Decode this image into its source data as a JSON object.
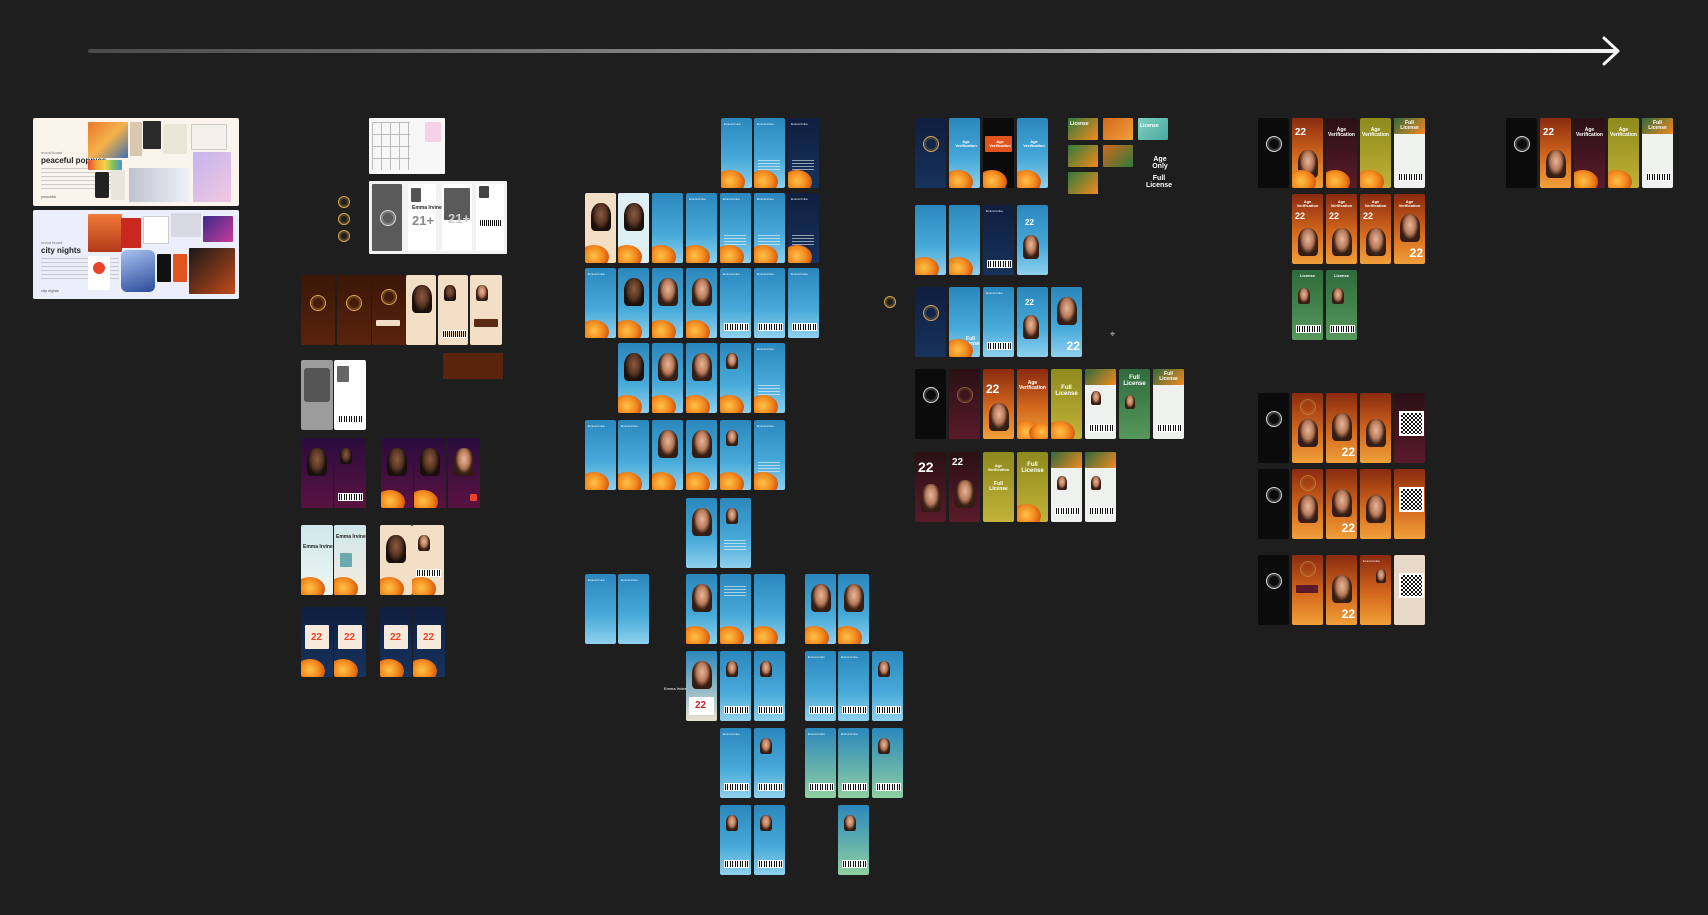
{
  "canvas": {
    "background": "#1e1e1e"
  },
  "moodboards": [
    {
      "eyebrow": "mood board",
      "title": "peaceful poppies",
      "body_label": "",
      "footer": "peaceful"
    },
    {
      "eyebrow": "mood board",
      "title": "city nights",
      "body_label": "",
      "footer": "city nights"
    }
  ],
  "screen_text": {
    "name": "Emma Irvine",
    "name_short": "Emma Irvine",
    "age": "22",
    "age_21": "21+",
    "age_verification": "Age Verification",
    "full_license": "Full License",
    "age_only": "Age Only",
    "license": "License",
    "full_license_short": "Full License"
  },
  "colors": {
    "sky": "#46a9d8",
    "poppy": "#f48a1e",
    "navy": "#0f1e3f",
    "brown": "#3a1608",
    "purple": "#2a0c3e",
    "sunset": "#d4681c",
    "olive": "#c2b238",
    "green": "#56985a"
  },
  "icons": {
    "arrow": "arrow-right-icon",
    "seal": "california-seal-icon",
    "qr": "qr-code-icon",
    "barcode": "barcode-icon",
    "cursor": "crosshair-icon"
  }
}
